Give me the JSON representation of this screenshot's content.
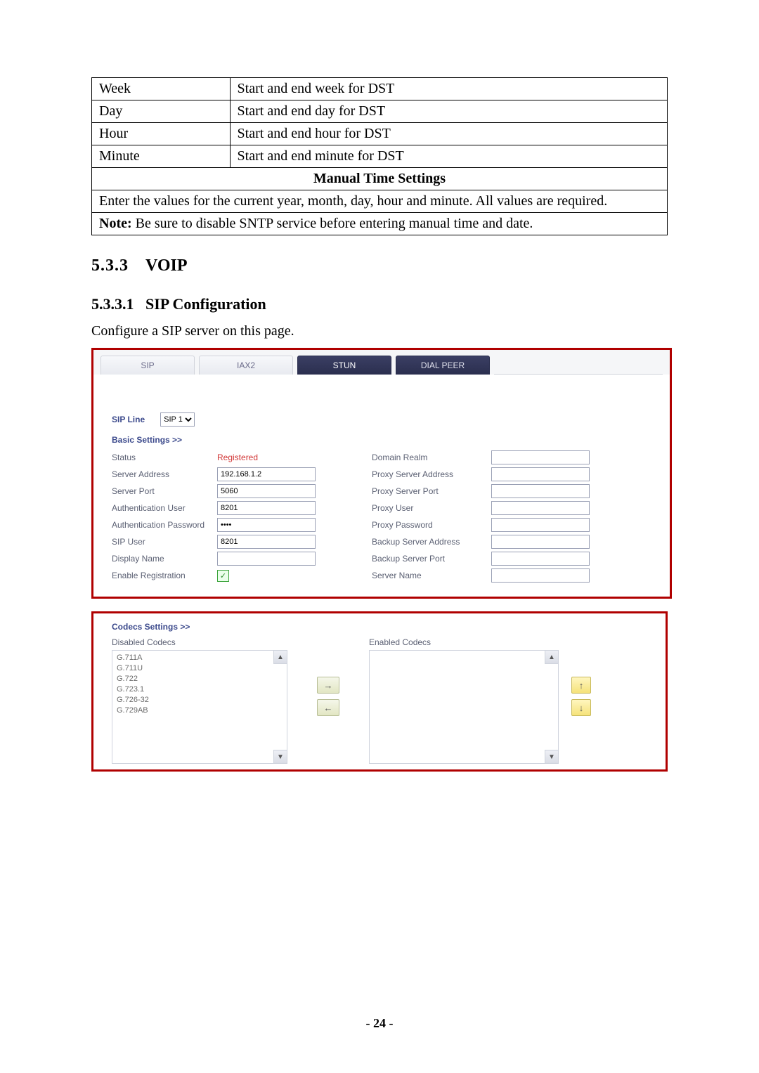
{
  "table": {
    "rows": [
      {
        "k": "Week",
        "v": "Start and end week for DST"
      },
      {
        "k": "Day",
        "v": "Start and end day for DST"
      },
      {
        "k": "Hour",
        "v": "Start and end hour for DST"
      },
      {
        "k": "Minute",
        "v": "Start and end minute for DST"
      }
    ],
    "manual_heading": "Manual Time Settings",
    "manual_text": "Enter the values for the current year, month, day, hour and minute.    All values are required.",
    "note_label": "Note:",
    "note_text": " Be sure to disable SNTP service before entering manual time and date."
  },
  "h2_num": "5.3.3",
  "h2_title": "VOIP",
  "h3_num": "5.3.3.1",
  "h3_title": "SIP Configuration",
  "lead": "Configure a SIP server on this page.",
  "tabs": {
    "sip": "SIP",
    "iax2": "IAX2",
    "stun": "STUN",
    "dialpeer": "DIAL PEER"
  },
  "sip_line": {
    "label": "SIP Line",
    "options": [
      "SIP 1"
    ]
  },
  "basic_title": "Basic Settings >>",
  "fields": {
    "status_lbl": "Status",
    "status_val": "Registered",
    "server_addr_lbl": "Server Address",
    "server_addr_val": "192.168.1.2",
    "server_port_lbl": "Server Port",
    "server_port_val": "5060",
    "auth_user_lbl": "Authentication User",
    "auth_user_val": "8201",
    "auth_pwd_lbl": "Authentication Password",
    "auth_pwd_val": "••••",
    "sip_user_lbl": "SIP User",
    "sip_user_val": "8201",
    "display_name_lbl": "Display Name",
    "display_name_val": "",
    "enable_reg_lbl": "Enable Registration",
    "domain_lbl": "Domain Realm",
    "proxy_addr_lbl": "Proxy Server Address",
    "proxy_port_lbl": "Proxy Server Port",
    "proxy_user_lbl": "Proxy User",
    "proxy_pwd_lbl": "Proxy Password",
    "backup_addr_lbl": "Backup Server Address",
    "backup_port_lbl": "Backup Server Port",
    "server_name_lbl": "Server Name"
  },
  "codecs": {
    "title": "Codecs Settings >>",
    "disabled_lbl": "Disabled Codecs",
    "enabled_lbl": "Enabled Codecs",
    "disabled_list": [
      "G.711A",
      "G.711U",
      "G.722",
      "G.723.1",
      "G.726-32",
      "G.729AB"
    ]
  },
  "page_number": "- 24 -"
}
